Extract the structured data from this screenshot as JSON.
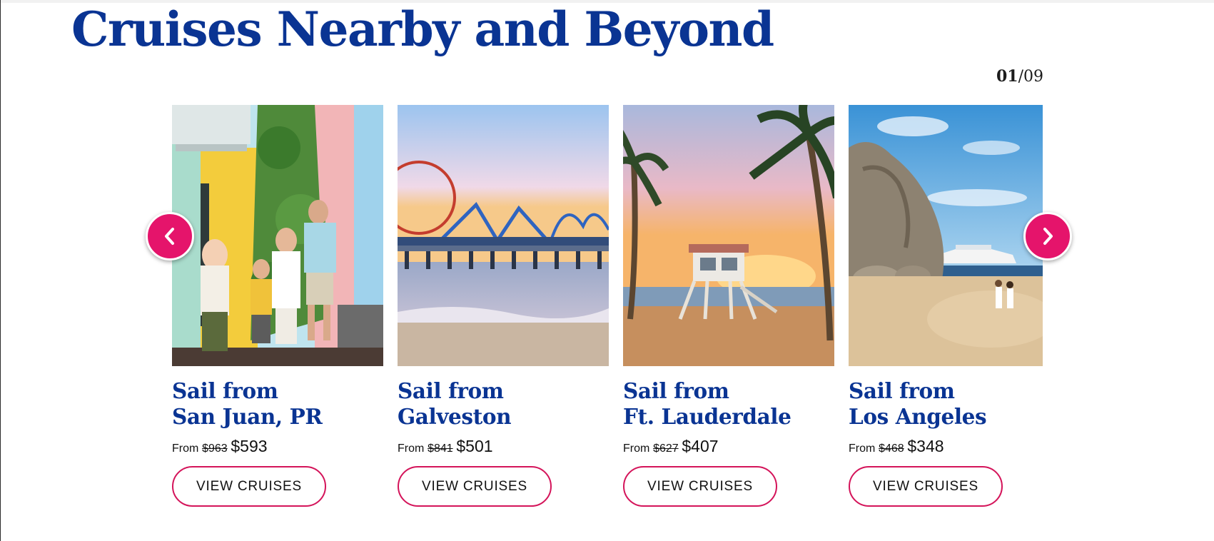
{
  "title": "Cruises Nearby and Beyond",
  "pager": {
    "current": "01",
    "separator": "/",
    "total": "09"
  },
  "colors": {
    "title": "#0a3493",
    "accent": "#e5146b",
    "button_border": "#d4145a"
  },
  "nav": {
    "prev_icon": "chevron-left-icon",
    "next_icon": "chevron-right-icon"
  },
  "cards": [
    {
      "line1": "Sail from",
      "line2": "San Juan, PR",
      "from": "From",
      "old_price": "$963",
      "new_price": "$593",
      "button": "VIEW CRUISES",
      "image": "family-colorful-street-photo"
    },
    {
      "line1": "Sail from",
      "line2": "Galveston",
      "from": "From",
      "old_price": "$841",
      "new_price": "$501",
      "button": "VIEW CRUISES",
      "image": "pier-amusement-park-photo"
    },
    {
      "line1": "Sail from",
      "line2": "Ft. Lauderdale",
      "from": "From",
      "old_price": "$627",
      "new_price": "$407",
      "button": "VIEW CRUISES",
      "image": "lifeguard-tower-sunset-photo"
    },
    {
      "line1": "Sail from",
      "line2": "Los Angeles",
      "from": "From",
      "old_price": "$468",
      "new_price": "$348",
      "button": "VIEW CRUISES",
      "image": "beach-rock-cruise-ship-photo"
    }
  ]
}
